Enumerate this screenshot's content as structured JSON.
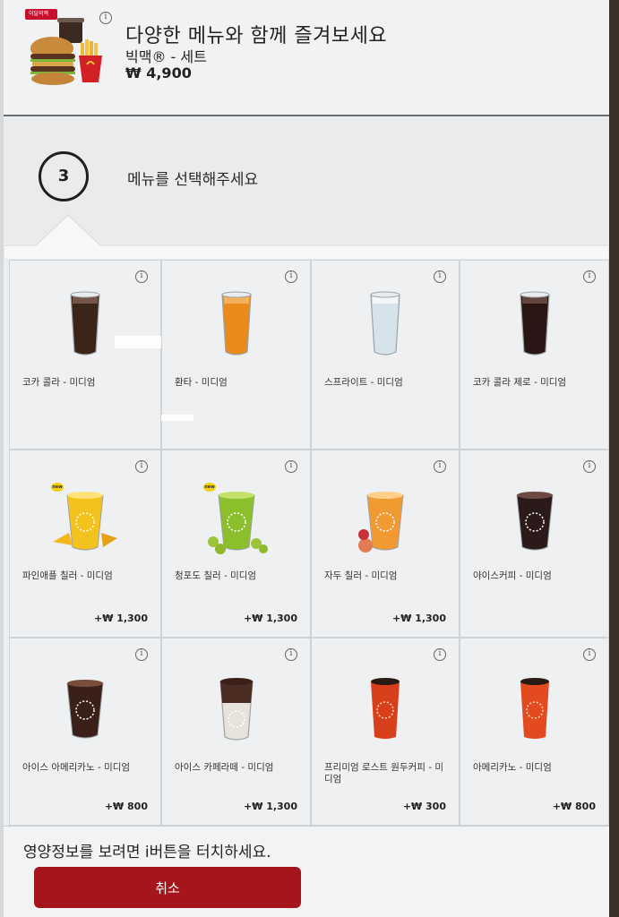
{
  "header": {
    "promo_title": "다양한 메뉴와 함께 즐겨보세요",
    "product_name": "빅맥® - 세트",
    "product_price": "₩ 4,900",
    "badge_text": "이달의맥",
    "info_icon": "i"
  },
  "step": {
    "number": "3",
    "instruction": "메뉴를 선택해주세요"
  },
  "menu": {
    "items": [
      {
        "name": "코카 콜라 - 미디엄",
        "price": "",
        "icon": "cola-glass-icon"
      },
      {
        "name": "환타 - 미디엄",
        "price": "",
        "icon": "fanta-glass-icon"
      },
      {
        "name": "스프라이트 - 미디엄",
        "price": "",
        "icon": "sprite-glass-icon"
      },
      {
        "name": "코카 콜라 제로 - 미디엄",
        "price": "",
        "icon": "cola-zero-glass-icon"
      },
      {
        "name": "파인애플 칠러 - 미디엄",
        "price": "+₩ 1,300",
        "badge": "new",
        "icon": "pineapple-chiller-icon"
      },
      {
        "name": "청포도 칠러 - 미디엄",
        "price": "+₩ 1,300",
        "badge": "new",
        "icon": "green-grape-chiller-icon"
      },
      {
        "name": "자두 칠러 - 미디엄",
        "price": "+₩ 1,300",
        "icon": "plum-chiller-icon"
      },
      {
        "name": "아이스커피 - 미디엄",
        "price": "",
        "icon": "iced-coffee-icon"
      },
      {
        "name": "아이스 아메리카노 - 미디엄",
        "price": "+₩ 800",
        "icon": "iced-americano-icon"
      },
      {
        "name": "아이스 카페라떼 - 미디엄",
        "price": "+₩ 1,300",
        "icon": "iced-cafe-latte-icon"
      },
      {
        "name": "프리미엄 로스트 원두커피 - 미디엄",
        "price": "+₩ 300",
        "icon": "premium-roast-coffee-icon"
      },
      {
        "name": "아메리카노 - 미디엄",
        "price": "+₩ 800",
        "icon": "americano-icon"
      }
    ]
  },
  "footer": {
    "nutrition_hint": "영양정보를 보려면 i버튼을 터치하세요.",
    "cancel_label": "취소"
  },
  "colors": {
    "brand_red": "#a6151b",
    "background": "#eceeef"
  }
}
